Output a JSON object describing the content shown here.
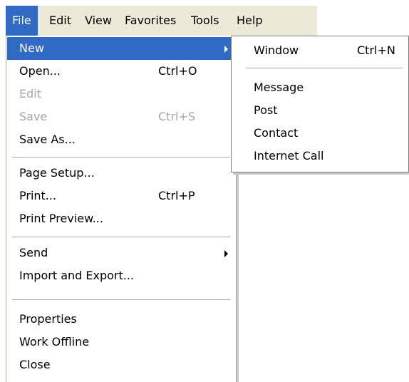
{
  "menubar": {
    "items": [
      {
        "label": "File",
        "active": true
      },
      {
        "label": "Edit"
      },
      {
        "label": "View"
      },
      {
        "label": "Favorites"
      },
      {
        "label": "Tools"
      },
      {
        "label": "Help"
      }
    ]
  },
  "file_menu": {
    "items": [
      {
        "label": "New",
        "shortcut": "",
        "submenu": true,
        "state": "highlighted"
      },
      {
        "label": "Open...",
        "shortcut": "Ctrl+O"
      },
      {
        "label": "Edit",
        "shortcut": "",
        "state": "disabled"
      },
      {
        "label": "Save",
        "shortcut": "Ctrl+S",
        "state": "disabled"
      },
      {
        "label": "Save As...",
        "shortcut": ""
      },
      {
        "label": "Page Setup...",
        "shortcut": ""
      },
      {
        "label": "Print...",
        "shortcut": "Ctrl+P"
      },
      {
        "label": "Print Preview...",
        "shortcut": ""
      },
      {
        "label": "Send",
        "shortcut": "",
        "submenu": true
      },
      {
        "label": "Import and Export...",
        "shortcut": ""
      },
      {
        "label": "Properties",
        "shortcut": ""
      },
      {
        "label": "Work Offline",
        "shortcut": ""
      },
      {
        "label": "Close",
        "shortcut": ""
      }
    ]
  },
  "new_submenu": {
    "items": [
      {
        "label": "Window",
        "shortcut": "Ctrl+N"
      },
      {
        "label": "Message",
        "shortcut": ""
      },
      {
        "label": "Post",
        "shortcut": ""
      },
      {
        "label": "Contact",
        "shortcut": ""
      },
      {
        "label": "Internet Call",
        "shortcut": ""
      }
    ]
  },
  "colors": {
    "highlight": "#316ac5",
    "menubar_bg": "#ece9d8",
    "disabled_text": "#a7a6aa"
  }
}
